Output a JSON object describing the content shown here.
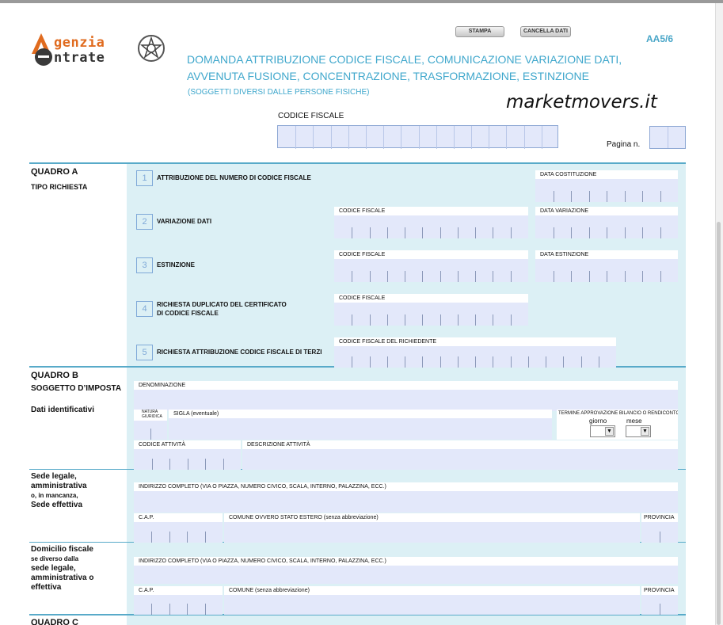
{
  "header": {
    "logo_line1": "genzia",
    "logo_line2": "ntrate",
    "print_button": "STAMPA",
    "clear_button": "CANCELLA DATI",
    "model_code": "AA5/6",
    "title_line1": "DOMANDA ATTRIBUZIONE CODICE FISCALE, COMUNICAZIONE VARIAZIONE DATI,",
    "title_line2": "AVVENUTA FUSIONE, CONCENTRAZIONE, TRASFORMAZIONE, ESTINZIONE",
    "subtitle": "(SOGGETTI DIVERSI DALLE PERSONE FISICHE)",
    "watermark": "marketmovers.it",
    "codice_fiscale_label": "CODICE FISCALE",
    "pagina_label": "Pagina n."
  },
  "quadro_a": {
    "title": "QUADRO A",
    "subtitle": "TIPO RICHIESTA",
    "options": [
      {
        "num": "1",
        "label": "ATTRIBUZIONE DEL NUMERO DI CODICE FISCALE"
      },
      {
        "num": "2",
        "label": "VARIAZIONE DATI"
      },
      {
        "num": "3",
        "label": "ESTINZIONE"
      },
      {
        "num": "4",
        "label": "RICHIESTA DUPLICATO DEL CERTIFICATO",
        "label2": "DI CODICE FISCALE"
      },
      {
        "num": "5",
        "label": "RICHIESTA ATTRIBUZIONE CODICE FISCALE DI TERZI"
      }
    ],
    "fields": {
      "data_costituzione": "DATA COSTITUZIONE",
      "cf_variazione": "CODICE FISCALE",
      "data_variazione": "DATA VARIAZIONE",
      "cf_estinzione": "CODICE FISCALE",
      "data_estinzione": "DATA ESTINZIONE",
      "cf_duplicato": "CODICE FISCALE",
      "cf_richiedente": "CODICE FISCALE DEL RICHIEDENTE"
    }
  },
  "quadro_b": {
    "title": "QUADRO B",
    "subtitle": "SOGGETTO D’IMPOSTA",
    "dati_identificativi": "Dati identificativi",
    "fields": {
      "denominazione": "DENOMINAZIONE",
      "natura_giuridica_1": "NATURA",
      "natura_giuridica_2": "GIURIDICA",
      "sigla": "SIGLA (eventuale)",
      "termine": "TERMINE APPROVAZIONE BILANCIO O RENDICONTO",
      "giorno": "giorno",
      "mese": "mese",
      "codice_attivita": "CODICE ATTIVITÀ",
      "descrizione_attivita": "DESCRIZIONE ATTIVITÀ"
    },
    "sede_legale": {
      "line1": "Sede legale,",
      "line2": "amministrativa",
      "line3": "o, in mancanza,",
      "line4": "Sede effettiva",
      "indirizzo": "INDIRIZZO COMPLETO (VIA O PIAZZA, NUMERO CIVICO, SCALA, INTERNO, PALAZZINA, ECC.)",
      "cap": "C.A.P.",
      "comune": "COMUNE OVVERO STATO ESTERO (senza abbreviazione)",
      "provincia": "PROVINCIA"
    },
    "domicilio": {
      "line1": "Domicilio fiscale",
      "line2": "se diverso dalla",
      "line3": "sede legale,",
      "line4": "amministrativa o",
      "line5": "effettiva",
      "indirizzo": "INDIRIZZO COMPLETO (VIA O PIAZZA, NUMERO CIVICO, SCALA, INTERNO, PALAZZINA, ECC.)",
      "cap": "C.A.P.",
      "comune": "COMUNE (senza abbreviazione)",
      "provincia": "PROVINCIA"
    }
  },
  "quadro_c": {
    "title": "QUADRO C"
  },
  "colors": {
    "accent": "#3fa7cc",
    "panel": "#dcf0f5",
    "input": "#e3e8fa",
    "logo_orange": "#e06b1f"
  }
}
